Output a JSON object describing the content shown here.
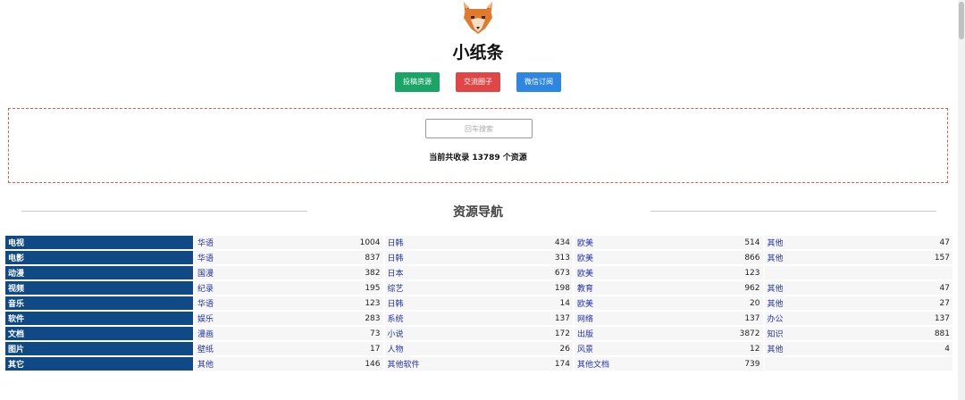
{
  "header": {
    "logo_icon": "fox-logo-icon",
    "site_title": "小纸条",
    "buttons": [
      {
        "label": "投稿资源",
        "color": "#1aa466"
      },
      {
        "label": "交流圈子",
        "color": "#e04646"
      },
      {
        "label": "微信订阅",
        "color": "#2f86e0"
      }
    ]
  },
  "search": {
    "placeholder": "回车搜索",
    "value": "",
    "count_text": "当前共收录 13789 个资源"
  },
  "navigation": {
    "title": "资源导航",
    "categories": [
      {
        "name": "电视",
        "items": [
          {
            "label": "华语",
            "count": "1004"
          },
          {
            "label": "日韩",
            "count": "434"
          },
          {
            "label": "欧美",
            "count": "514"
          },
          {
            "label": "其他",
            "count": "47"
          }
        ]
      },
      {
        "name": "电影",
        "items": [
          {
            "label": "华语",
            "count": "837"
          },
          {
            "label": "日韩",
            "count": "313"
          },
          {
            "label": "欧美",
            "count": "866"
          },
          {
            "label": "其他",
            "count": "157"
          }
        ]
      },
      {
        "name": "动漫",
        "items": [
          {
            "label": "国漫",
            "count": "382"
          },
          {
            "label": "日本",
            "count": "673"
          },
          {
            "label": "欧美",
            "count": "123"
          }
        ]
      },
      {
        "name": "视频",
        "items": [
          {
            "label": "纪录",
            "count": "195"
          },
          {
            "label": "综艺",
            "count": "198"
          },
          {
            "label": "教育",
            "count": "962"
          },
          {
            "label": "其他",
            "count": "47"
          }
        ]
      },
      {
        "name": "音乐",
        "items": [
          {
            "label": "华语",
            "count": "123"
          },
          {
            "label": "日韩",
            "count": "14"
          },
          {
            "label": "欧美",
            "count": "20"
          },
          {
            "label": "其他",
            "count": "27"
          }
        ]
      },
      {
        "name": "软件",
        "items": [
          {
            "label": "娱乐",
            "count": "283"
          },
          {
            "label": "系统",
            "count": "137"
          },
          {
            "label": "网络",
            "count": "137"
          },
          {
            "label": "办公",
            "count": "137"
          }
        ]
      },
      {
        "name": "文档",
        "items": [
          {
            "label": "漫画",
            "count": "73"
          },
          {
            "label": "小说",
            "count": "172"
          },
          {
            "label": "出版",
            "count": "3872"
          },
          {
            "label": "知识",
            "count": "881"
          }
        ]
      },
      {
        "name": "图片",
        "items": [
          {
            "label": "壁纸",
            "count": "17"
          },
          {
            "label": "人物",
            "count": "26"
          },
          {
            "label": "风景",
            "count": "12"
          },
          {
            "label": "其他",
            "count": "4"
          }
        ]
      },
      {
        "name": "其它",
        "items": [
          {
            "label": "其他",
            "count": "146"
          },
          {
            "label": "其他软件",
            "count": "174"
          },
          {
            "label": "其他文档",
            "count": "739"
          }
        ]
      }
    ]
  },
  "colors": {
    "category_bg": "#0f4a87",
    "link": "#2233aa",
    "search_border": "#e05a4a"
  }
}
